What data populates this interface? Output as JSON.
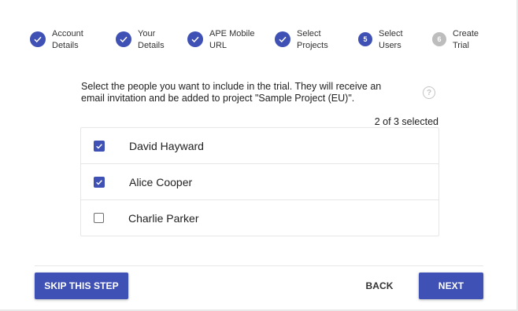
{
  "stepper": {
    "steps": [
      {
        "line1": "Account",
        "line2": "Details",
        "state": "done"
      },
      {
        "line1": "Your",
        "line2": "Details",
        "state": "done"
      },
      {
        "line1": "APE Mobile",
        "line2": "URL",
        "state": "done"
      },
      {
        "line1": "Select",
        "line2": "Projects",
        "state": "done"
      },
      {
        "line1": "Select",
        "line2": "Users",
        "state": "active",
        "number": "5"
      },
      {
        "line1": "Create",
        "line2": "Trial",
        "state": "pending",
        "number": "6"
      }
    ]
  },
  "content": {
    "intro_line1": "Select the people you want to include in the trial. They will receive an",
    "intro_line2": "email invitation and be added to project \"Sample Project (EU)\".",
    "help_glyph": "?",
    "selected_count": "2 of 3 selected"
  },
  "users": [
    {
      "name": "David Hayward",
      "checked": true
    },
    {
      "name": "Alice Cooper",
      "checked": true
    },
    {
      "name": "Charlie Parker",
      "checked": false
    }
  ],
  "footer": {
    "skip_label": "SKIP THIS STEP",
    "back_label": "BACK",
    "next_label": "NEXT"
  },
  "colors": {
    "primary": "#3f51b5",
    "pending": "#bdbdbd"
  },
  "icons": {
    "done": "check-icon",
    "help": "help-circle-icon",
    "checkbox_checked": "checkbox-checked-icon",
    "checkbox_unchecked": "checkbox-unchecked-icon"
  }
}
